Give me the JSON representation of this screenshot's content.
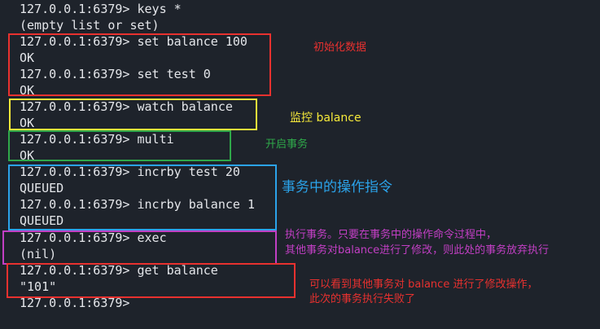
{
  "terminal": {
    "lines": [
      "127.0.0.1:6379> keys *",
      "(empty list or set)",
      "127.0.0.1:6379> set balance 100",
      "OK",
      "127.0.0.1:6379> set test 0",
      "OK",
      "127.0.0.1:6379> watch balance",
      "OK",
      "127.0.0.1:6379> multi",
      "OK",
      "127.0.0.1:6379> incrby test 20",
      "QUEUED",
      "127.0.0.1:6379> incrby balance 1",
      "QUEUED",
      "127.0.0.1:6379> exec",
      "(nil)",
      "127.0.0.1:6379> get balance",
      "\"101\"",
      "127.0.0.1:6379>"
    ]
  },
  "annotations": {
    "init_data": {
      "text": "初始化数据",
      "color": "#e8312f"
    },
    "watch_balance": {
      "text": "监控 balance",
      "color": "#f6e93a"
    },
    "start_transaction": {
      "text": "开启事务",
      "color": "#2fa84a"
    },
    "transaction_ops": {
      "text": "事务中的操作指令",
      "color": "#2ba3ea"
    },
    "exec_note": {
      "line1": "执行事务。只要在事务中的操作命令过程中，",
      "line2": "其他事务对balance进行了修改，则此处的事务放弃执行",
      "color": "#c23fc4"
    },
    "result_note": {
      "line1": "可以看到其他事务对 balance 进行了修改操作，",
      "line2": "此次的事务执行失败了",
      "color": "#e8312f"
    }
  },
  "colors": {
    "background": "#1e232b",
    "text": "#e4e6ea"
  }
}
